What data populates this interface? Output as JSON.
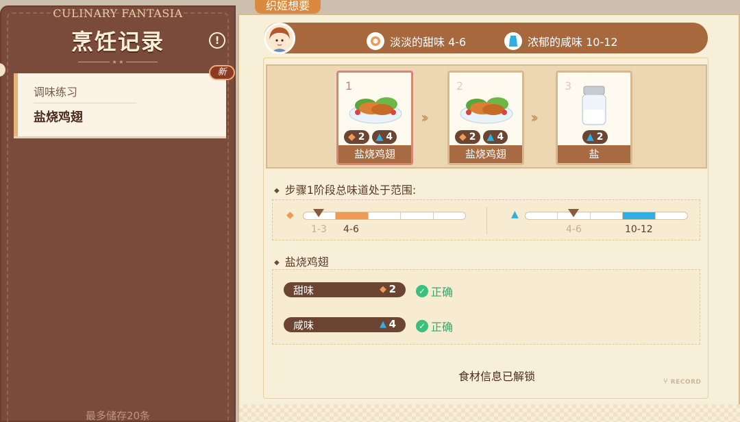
{
  "left": {
    "brand": "CULINARY FANTASIA",
    "title": "烹饪记录",
    "info_icon": "exclamation-icon",
    "record": {
      "category": "调味练习",
      "name": "盐烧鸡翅",
      "badge": "新"
    },
    "storage_note": "最多储存20条"
  },
  "header": {
    "requester": "织姬想要"
  },
  "request": {
    "items": [
      {
        "icon": "candy-icon",
        "text": "淡淡的甜味 4-6"
      },
      {
        "icon": "salt-icon",
        "text": "浓郁的咸味 10-12"
      }
    ]
  },
  "steps": [
    {
      "num": "1",
      "name": "盐烧鸡翅",
      "sweet": "2",
      "salty": "4",
      "active": true
    },
    {
      "num": "2",
      "name": "盐烧鸡翅",
      "sweet": "2",
      "salty": "4",
      "active": false
    },
    {
      "num": "3",
      "name": "盐",
      "salty": "2",
      "active": false
    }
  ],
  "range_section": {
    "title": "步骤1阶段总味道处于范围:",
    "sweet": {
      "current": "1-3",
      "target": "4-6"
    },
    "salty": {
      "current": "4-6",
      "target": "10-12"
    }
  },
  "dish_section": {
    "title": "盐烧鸡翅",
    "tastes": [
      {
        "name": "甜味",
        "value": "2",
        "result": "正确"
      },
      {
        "name": "咸味",
        "value": "4",
        "result": "正确"
      }
    ]
  },
  "footer": {
    "unlocked": "食材信息已解锁",
    "stamp": "RECORD"
  },
  "colors": {
    "sweet": "#ef9a57",
    "salty": "#2eaee3",
    "correct": "#3bbf7d",
    "panel": "#7a4a3a"
  }
}
